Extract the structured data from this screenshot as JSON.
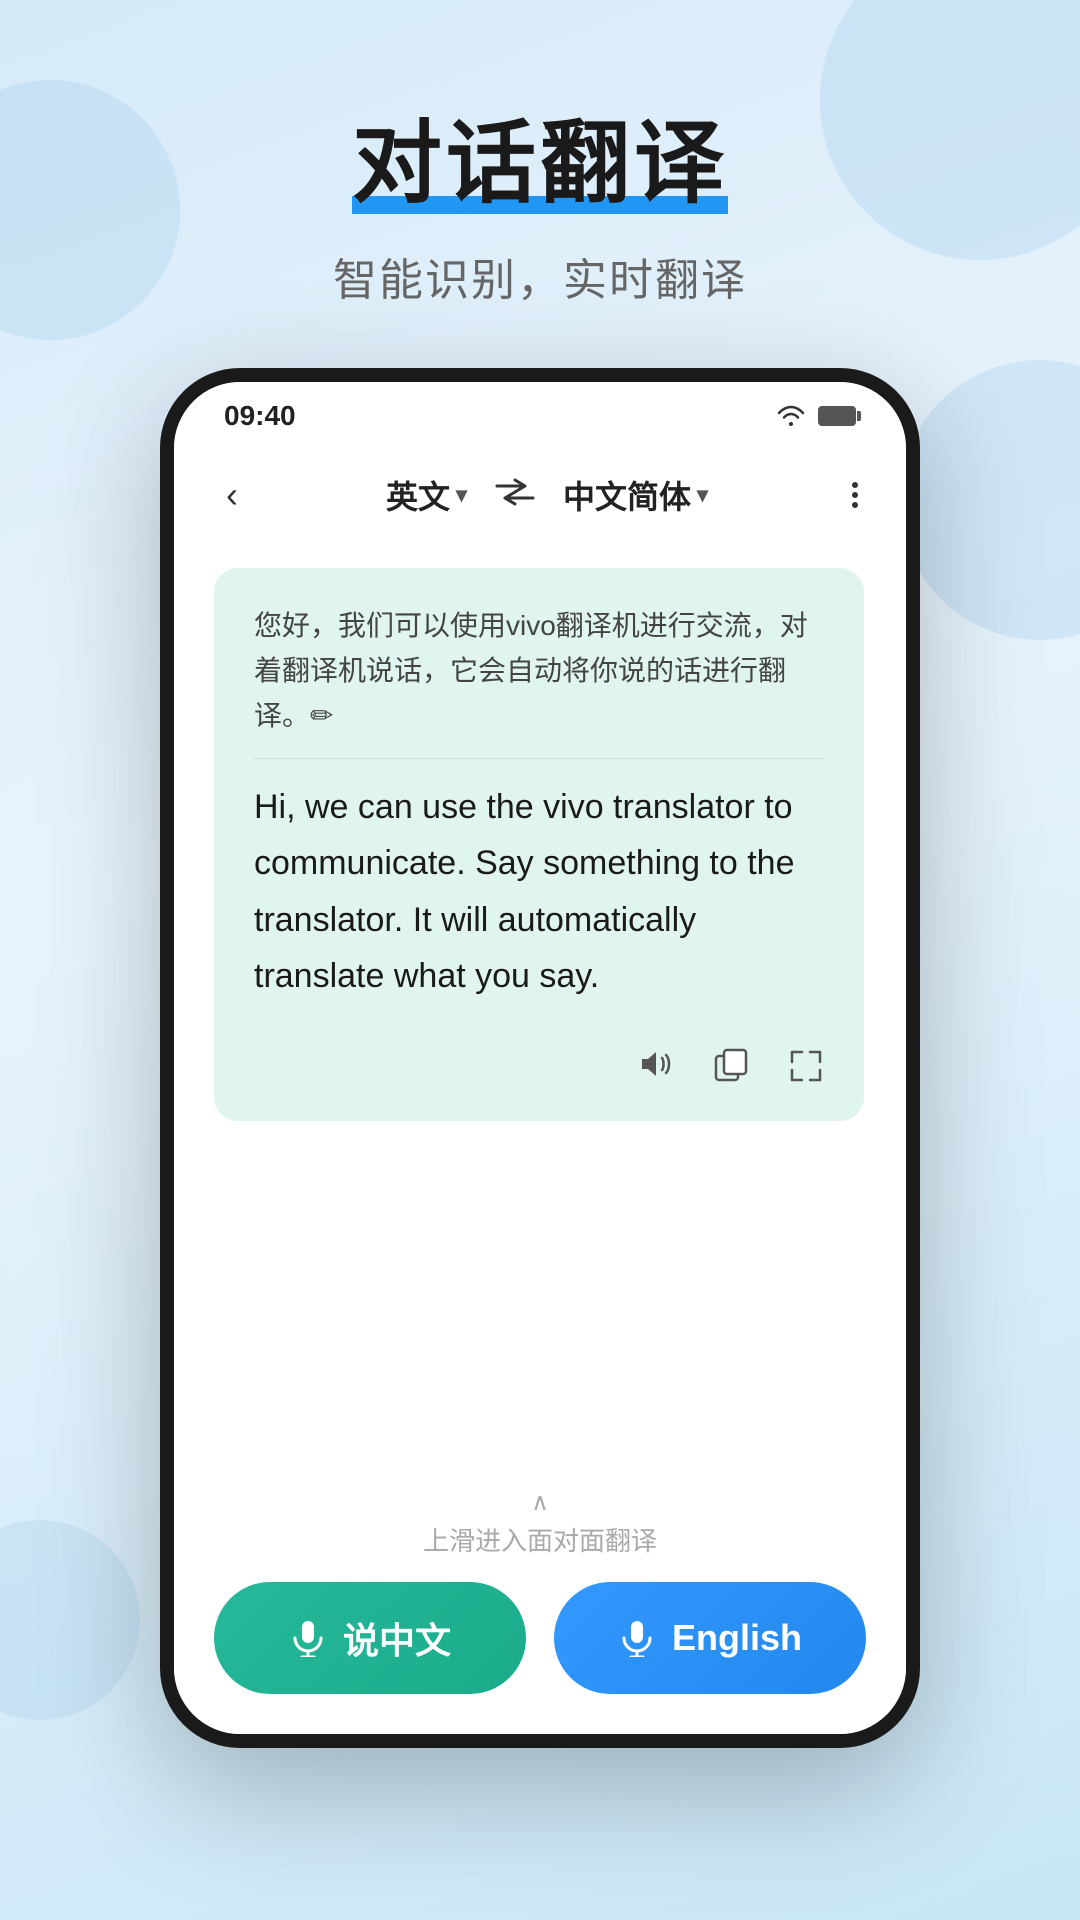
{
  "background": {
    "color": "#d6eaf8"
  },
  "header": {
    "title": "对话翻译",
    "subtitle": "智能识别，实时翻译"
  },
  "status_bar": {
    "time": "09:40",
    "wifi": "wifi",
    "battery": "battery"
  },
  "app_bar": {
    "back_label": "‹",
    "lang_left": "英文",
    "lang_left_chevron": "▾",
    "swap": "⇄",
    "lang_right": "中文简体",
    "lang_right_chevron": "▾"
  },
  "message": {
    "original": "您好，我们可以使用vivo翻译机进行交流，对着翻译机说话，它会自动将你说的话进行翻译。✏",
    "translation": "Hi, we can use the vivo translator to communicate. Say something to the translator. It will  automatically translate what you say."
  },
  "message_actions": {
    "volume": "🔊",
    "copy": "⧉",
    "expand": "⛶"
  },
  "bottom": {
    "slide_arrow": "∧",
    "slide_text": "上滑进入面对面翻译",
    "btn_chinese_label": "说中文",
    "btn_english_label": "English",
    "voice_icon": "🎤"
  }
}
